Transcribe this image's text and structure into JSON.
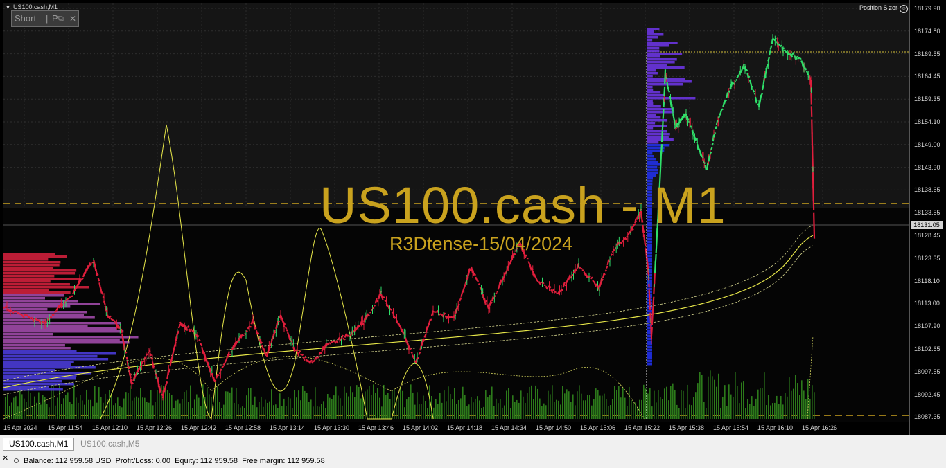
{
  "chart": {
    "symbol_title": "US100.cash,M1",
    "short_panel": {
      "label": "Short",
      "sep": "|",
      "p_label": "P"
    },
    "position_sizer": "Position Sizer",
    "watermark": "US100.cash - M1",
    "watermark_sub": "R3Dtense-15/04/2024",
    "current_price": "18131.05",
    "price_labels": [
      "18179.90",
      "18174.80",
      "18169.55",
      "18164.45",
      "18159.35",
      "18154.10",
      "18149.00",
      "18143.90",
      "18138.65",
      "18133.55",
      "18128.45",
      "18123.35",
      "18118.10",
      "18113.00",
      "18107.90",
      "18102.65",
      "18097.55",
      "18092.45",
      "18087.35"
    ],
    "time_labels": [
      "15 Apr 2024",
      "15 Apr 11:54",
      "15 Apr 12:10",
      "15 Apr 12:26",
      "15 Apr 12:42",
      "15 Apr 12:58",
      "15 Apr 13:14",
      "15 Apr 13:30",
      "15 Apr 13:46",
      "15 Apr 14:02",
      "15 Apr 14:18",
      "15 Apr 14:34",
      "15 Apr 14:50",
      "15 Apr 15:06",
      "15 Apr 15:22",
      "15 Apr 15:38",
      "15 Apr 15:54",
      "15 Apr 16:10",
      "15 Apr 16:26"
    ],
    "colors": {
      "up": "#2fe06a",
      "down": "#e01e3c",
      "watermark": "#c9a21e",
      "ma": "#e8e84a"
    }
  },
  "tabs": [
    {
      "label": "US100.cash,M1",
      "active": true
    },
    {
      "label": "US100.cash,M5",
      "active": false
    }
  ],
  "status": {
    "text": "Balance: 112 959.58 USD  Profit/Loss: 0.00  Equity: 112 959.58  Free margin: 112 959.58"
  }
}
